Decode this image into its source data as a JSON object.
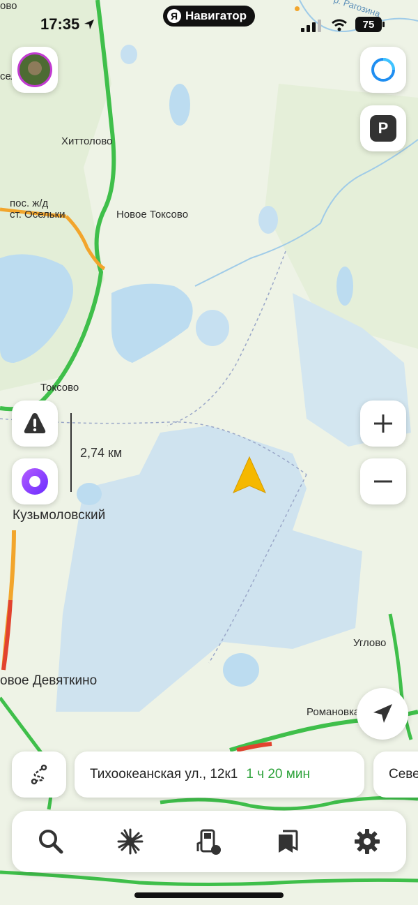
{
  "status_bar": {
    "time": "17:35",
    "app_pill": "Навигатор",
    "app_pill_logo": "Я",
    "battery": "75"
  },
  "map": {
    "labels": [
      "Хиттолово",
      "пос. ж/д",
      "ст. Осельки",
      "Новое Токсово",
      "Токсово",
      "Кузьмоловский",
      "овое Девяткино",
      "Углово",
      "Романовка",
      "р. Рагозина",
      "сел",
      "ово"
    ],
    "scale_label": "2,74 км"
  },
  "route_card": {
    "address": "Тихоокеанская ул., 12к1",
    "eta": "1 ч 20 мин"
  },
  "route_card_next": {
    "text": "Севе"
  },
  "toolbar": {
    "icons": [
      "search-icon",
      "explore-icon",
      "gas-station-icon",
      "bookmarks-icon",
      "settings-icon"
    ]
  },
  "colors": {
    "map_bg": "#eef3e6",
    "water": "#bcdcf0",
    "road_green": "#3fbf4a",
    "road_orange": "#f2a52c",
    "road_red": "#e2432f",
    "arrow": "#f5b800",
    "alice": "#8a4cff",
    "eta_green": "#2fa33c"
  }
}
